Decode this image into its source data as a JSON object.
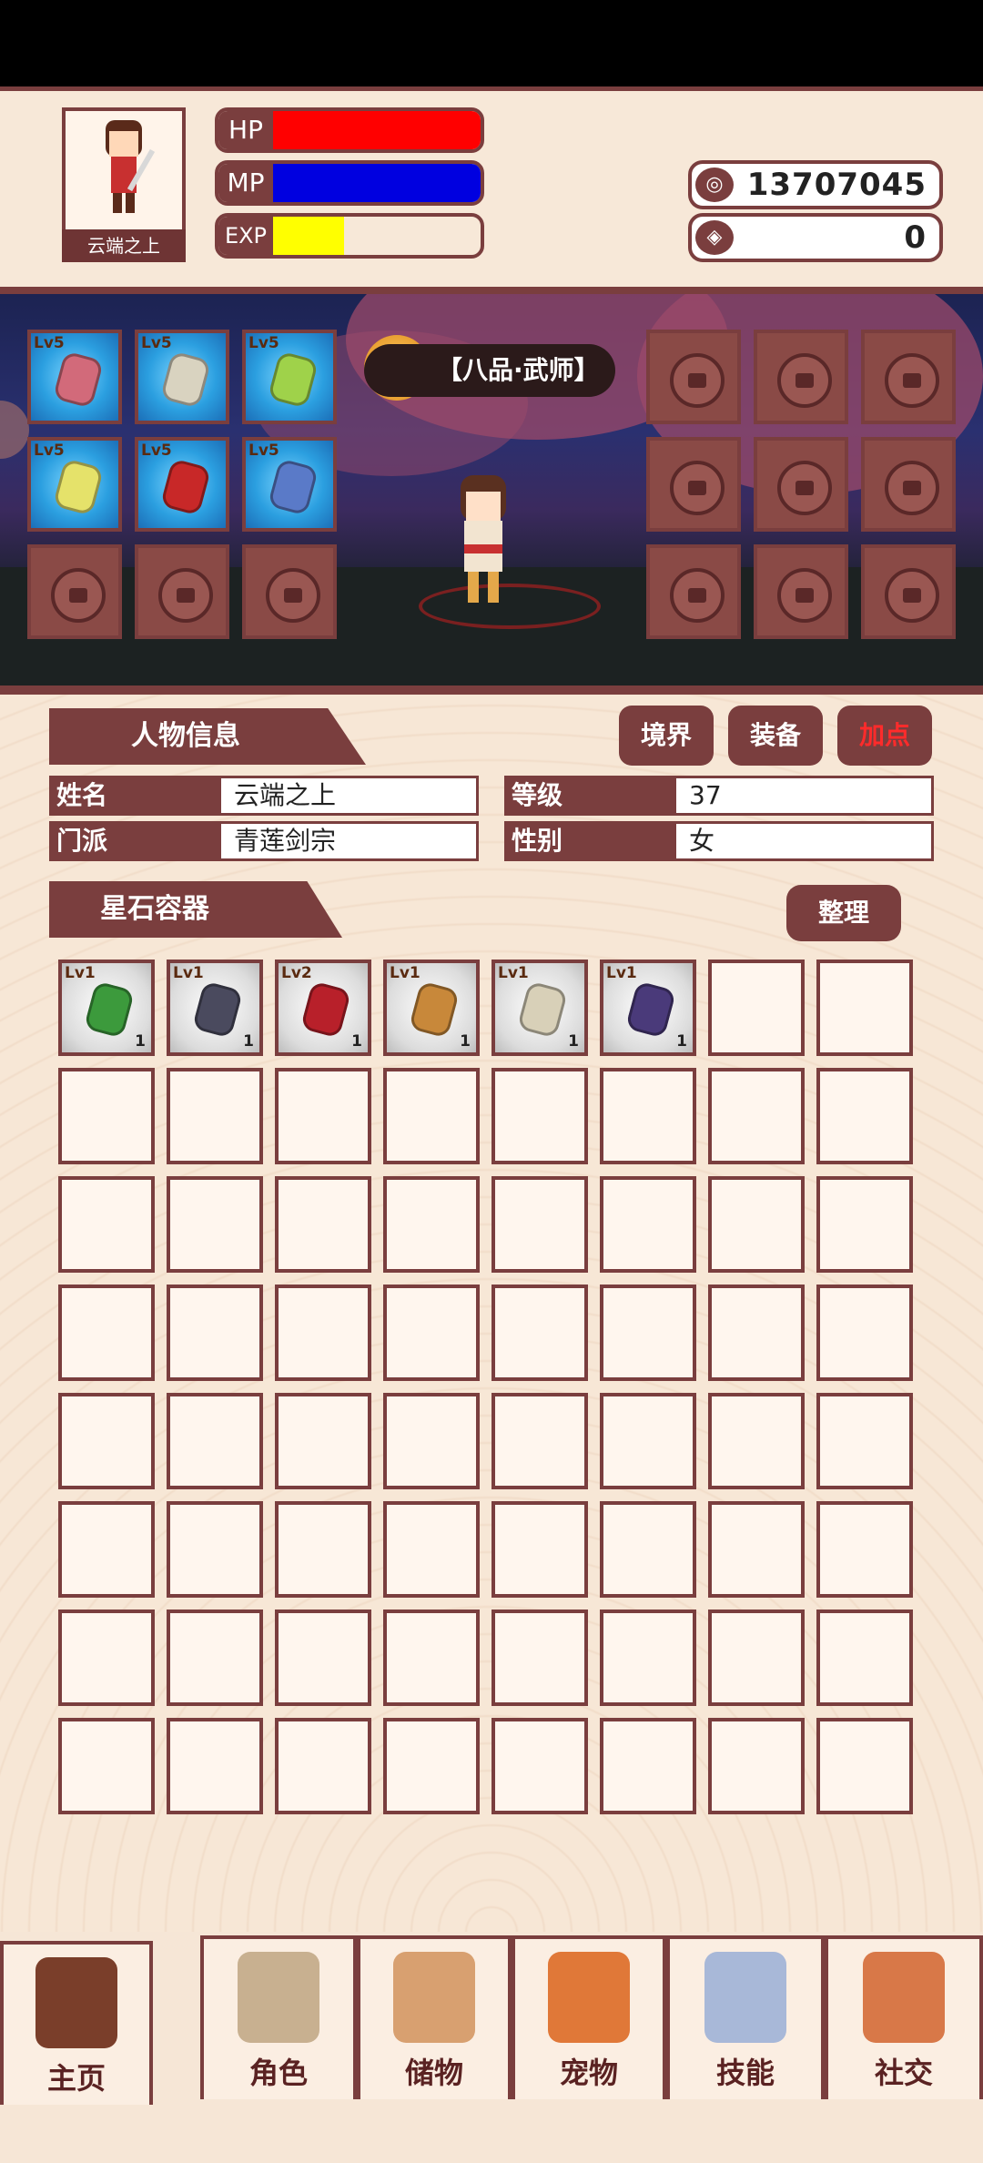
{
  "player": {
    "name": "云端之上",
    "hp_label": "HP",
    "mp_label": "MP",
    "exp_label": "EXP",
    "hp_fraction": 1.0,
    "mp_fraction": 1.0,
    "exp_fraction": 0.34,
    "hp_color": "#ff0000",
    "mp_color": "#0000e0",
    "exp_color": "#ffff00"
  },
  "currency": {
    "coins_icon": "coin-icon",
    "coins": "13707045",
    "gems_icon": "gem-icon",
    "gems": "0"
  },
  "realm": {
    "badge": "境界",
    "title": "【八品·武师】"
  },
  "equipped_slots": {
    "left": [
      {
        "lv": "Lv5",
        "color": "#d26a7a"
      },
      {
        "lv": "Lv5",
        "color": "#d9d3c0"
      },
      {
        "lv": "Lv5",
        "color": "#9fd24a"
      },
      {
        "lv": "Lv5",
        "color": "#e5e26a"
      },
      {
        "lv": "Lv5",
        "color": "#c82828"
      },
      {
        "lv": "Lv5",
        "color": "#5a7ac8"
      }
    ]
  },
  "info": {
    "section_title": "人物信息",
    "tabs": [
      "境界",
      "装备",
      "加点"
    ],
    "active_tab_color": "#ff2b2b",
    "name_label": "姓名",
    "name_value": "云端之上",
    "level_label": "等级",
    "level_value": "37",
    "sect_label": "门派",
    "sect_value": "青莲剑宗",
    "gender_label": "性别",
    "gender_value": "女"
  },
  "container": {
    "section_title": "星石容器",
    "sort_label": "整理",
    "items": [
      {
        "lv": "Lv1",
        "count": "1",
        "color": "#3c9a3c"
      },
      {
        "lv": "Lv1",
        "count": "1",
        "color": "#4a4a5e"
      },
      {
        "lv": "Lv2",
        "count": "1",
        "color": "#b8202a"
      },
      {
        "lv": "Lv1",
        "count": "1",
        "color": "#c8883a"
      },
      {
        "lv": "Lv1",
        "count": "1",
        "color": "#d8d0b8"
      },
      {
        "lv": "Lv1",
        "count": "1",
        "color": "#4a3a7a"
      }
    ]
  },
  "nav": {
    "items": [
      {
        "label": "主页",
        "icon": "gate-icon"
      },
      {
        "label": "角色",
        "icon": "character-icon"
      },
      {
        "label": "储物",
        "icon": "bag-icon"
      },
      {
        "label": "宠物",
        "icon": "fox-icon"
      },
      {
        "label": "技能",
        "icon": "sword-icon"
      },
      {
        "label": "社交",
        "icon": "handshake-icon"
      }
    ]
  }
}
